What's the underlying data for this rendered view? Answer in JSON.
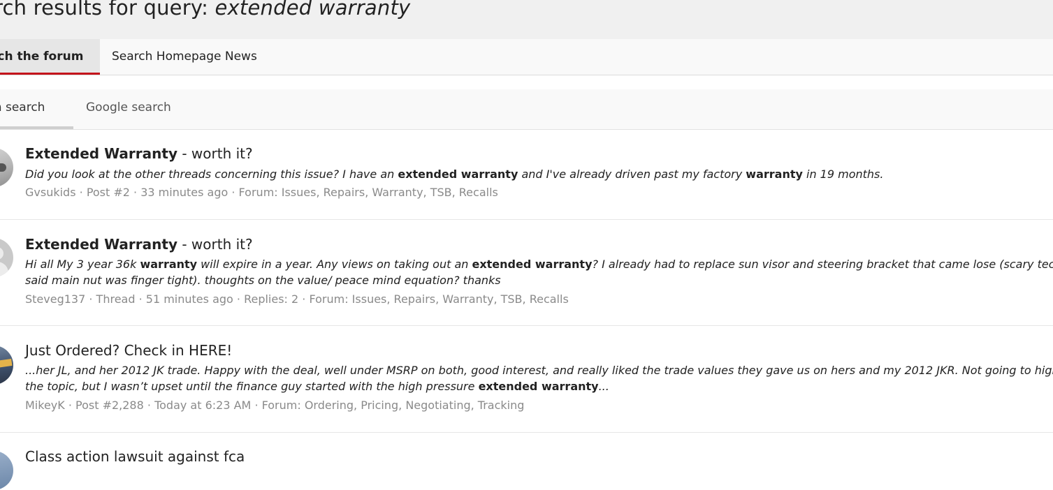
{
  "header": {
    "title_prefix": "rch results for query: ",
    "query": "extended warranty"
  },
  "tabs_main": [
    {
      "label": "rch the forum"
    },
    {
      "label": "Search Homepage News"
    }
  ],
  "tabs_sub": [
    {
      "label": "m search"
    },
    {
      "label": "Google search"
    }
  ],
  "results": [
    {
      "title_bold": "Extended Warranty",
      "title_rest": " - worth it?",
      "snippet_parts": [
        "Did you look at the other threads concerning this issue? I have an ",
        "extended warranty",
        " and I've already driven past my factory ",
        "warranty",
        " in 19 months."
      ],
      "author": "Gvsukids",
      "sep1": " · ",
      "kind": "Post #2",
      "sep2": " · ",
      "time": "33 minutes ago",
      "sep3": " · ",
      "forum_label": "Forum: ",
      "forum": "Issues, Repairs, Warranty, TSB, Recalls"
    },
    {
      "title_bold": "Extended Warranty",
      "title_rest": " - worth it?",
      "snippet_line1_parts": [
        "Hi all My 3 year 36k ",
        "warranty",
        " will expire in a year. Any views on taking out an ",
        "extended warranty",
        "? I already had to replace sun visor and steering bracket that came lose (scary tech"
      ],
      "snippet_line2": "said main nut was finger tight). thoughts on the value/ peace mind equation? thanks",
      "author": "Steveg137",
      "sep1": " · ",
      "kind": "Thread",
      "sep2": " · ",
      "time": "51 minutes ago",
      "sep3": " · ",
      "replies": "Replies: 2",
      "sep4": " · ",
      "forum_label": "Forum: ",
      "forum": "Issues, Repairs, Warranty, TSB, Recalls"
    },
    {
      "title": "Just Ordered? Check in HERE!",
      "snippet_line1": "...her JL, and her 2012 JK trade. Happy with the deal, well under MSRP on both, good interest, and really liked the trade values they gave us on hers and my 2012 JKR. Not going to high jack",
      "snippet_line2_parts": [
        "the topic, but I wasn’t upset until the finance guy started with the high pressure ",
        "extended warranty",
        "..."
      ],
      "author": "MikeyK",
      "sep1": " · ",
      "kind": "Post #2,288",
      "sep2": " · ",
      "time": "Today at 6:23 AM",
      "sep3": " · ",
      "forum_label": "Forum: ",
      "forum": "Ordering, Pricing, Negotiating, Tracking"
    },
    {
      "title": "Class action lawsuit against fca"
    }
  ]
}
